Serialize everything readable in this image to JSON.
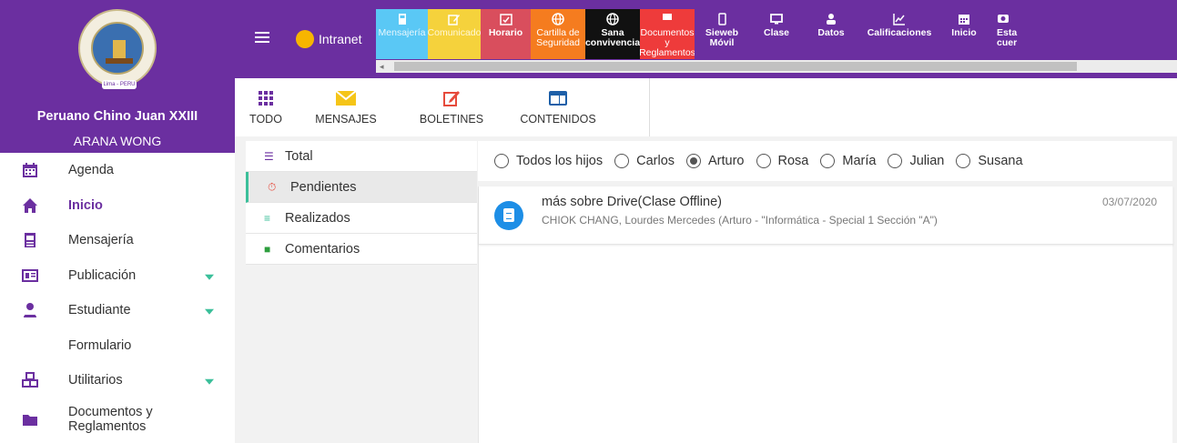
{
  "sidebar": {
    "school": "Peruano Chino Juan XXIII",
    "user": "ARANA WONG",
    "logo_text": "Lima - PERU",
    "items": [
      {
        "label": "Agenda",
        "icon": "calendar-icon"
      },
      {
        "label": "Inicio",
        "icon": "home-icon",
        "active": true
      },
      {
        "label": "Mensajería",
        "icon": "envelope-icon"
      },
      {
        "label": "Publicación",
        "icon": "newspaper-icon",
        "expandable": true
      },
      {
        "label": "Estudiante",
        "icon": "student-icon",
        "expandable": true
      },
      {
        "label": "Formulario",
        "icon": ""
      },
      {
        "label": "Utilitarios",
        "icon": "cubes-icon",
        "expandable": true
      },
      {
        "label": "Documentos y Reglamentos",
        "icon": "folder-icon"
      }
    ]
  },
  "topbar": {
    "intranet": "Intranet",
    "tabs": [
      {
        "label": "Mensajería",
        "color": "#5ac8f5",
        "icon": "envelope-icon"
      },
      {
        "label": "Comunicado",
        "color": "#f5d23c",
        "icon": "edit-icon"
      },
      {
        "label": "Horario",
        "color": "#d94e5d",
        "icon": "calendar-check-icon"
      },
      {
        "label": "Cartilla de Seguridad",
        "color": "#f57c1f",
        "icon": "globe-icon"
      },
      {
        "label": "Sana convivencia",
        "color": "#111111",
        "icon": "globe-icon"
      },
      {
        "label": "Documentos y Reglamentos",
        "color": "#ee3b3b",
        "icon": "folder-icon"
      },
      {
        "label": "Sieweb Móvil",
        "color": "#6b2fa0",
        "icon": "mobile-icon"
      },
      {
        "label": "Clase",
        "color": "#6b2fa0",
        "icon": "monitor-icon"
      },
      {
        "label": "Datos",
        "color": "#6b2fa0",
        "icon": "user-icon"
      },
      {
        "label": "Calificaciones",
        "color": "#6b2fa0",
        "icon": "chart-line-icon"
      },
      {
        "label": "Inicio",
        "color": "#6b2fa0",
        "icon": "calendar-icon"
      },
      {
        "label": "Esta cuer",
        "color": "#6b2fa0",
        "icon": "eye-icon"
      }
    ]
  },
  "categories": [
    {
      "label": "TODO",
      "icon": "grid-icon"
    },
    {
      "label": "MENSAJES",
      "icon": "envelope-icon"
    },
    {
      "label": "BOLETINES",
      "icon": "edit-icon"
    },
    {
      "label": "CONTENIDOS",
      "icon": "window-icon"
    }
  ],
  "status": [
    {
      "label": "Total",
      "icon": "list-icon",
      "color": "#6b2fa0"
    },
    {
      "label": "Pendientes",
      "icon": "stopwatch-icon",
      "color": "#e64a3b",
      "selected": true
    },
    {
      "label": "Realizados",
      "icon": "check-list-icon",
      "color": "#3bbf9a"
    },
    {
      "label": "Comentarios",
      "icon": "comment-icon",
      "color": "#2e9e3e"
    }
  ],
  "children": {
    "options": [
      "Todos los hijos",
      "Carlos",
      "Arturo",
      "Rosa",
      "María",
      "Julian",
      "Susana"
    ],
    "selected": "Arturo"
  },
  "messages": [
    {
      "title": "más sobre Drive(Clase Offline)",
      "subtitle": "CHIOK CHANG, Lourdes Mercedes (Arturo - \"Informática - Special 1 Sección \"A\")",
      "date": "03/07/2020"
    }
  ]
}
